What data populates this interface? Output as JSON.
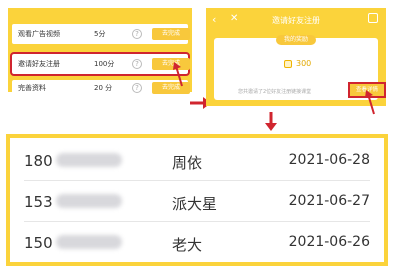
{
  "tasks": {
    "rows": [
      {
        "name": "观看广告视频",
        "points": "5分",
        "help": "?",
        "action": "去完成"
      },
      {
        "name": "邀请好友注册",
        "points": "100分",
        "help": "?",
        "action": "去完成"
      },
      {
        "name": "完善资料",
        "points": "20 分",
        "help": "?",
        "action": "去完成"
      }
    ]
  },
  "invite": {
    "title": "邀请好友注册",
    "back_icon": "‹",
    "close_icon": "✕",
    "reward_tag": "我的奖励",
    "points": "300",
    "note": "您共邀请了2位好友注册链接课堂",
    "view_label": "查看详情"
  },
  "detail": {
    "rows": [
      {
        "phone": "180",
        "name": "周依",
        "date": "2021-06-28"
      },
      {
        "phone": "153",
        "name": "派大星",
        "date": "2021-06-27"
      },
      {
        "phone": "150",
        "name": "老大",
        "date": "2021-06-26"
      }
    ]
  },
  "colors": {
    "accent": "#fbd33b",
    "button": "#f8c83c",
    "highlight": "#d0252f"
  }
}
